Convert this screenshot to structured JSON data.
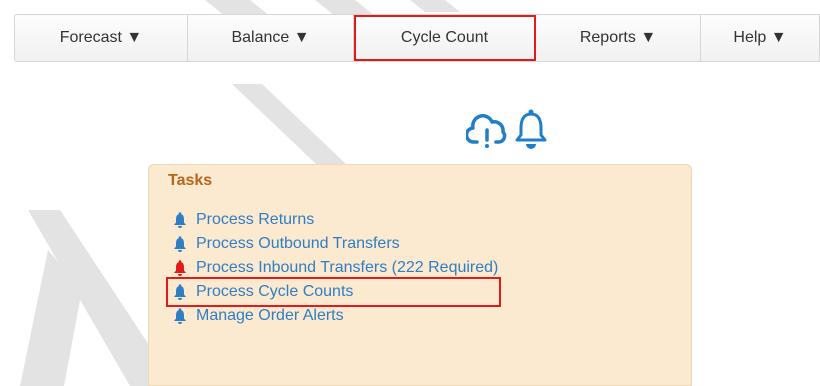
{
  "nav": {
    "items": [
      {
        "label": "Forecast ▼"
      },
      {
        "label": "Balance ▼"
      },
      {
        "label": "Cycle Count"
      },
      {
        "label": "Reports ▼"
      },
      {
        "label": "Help ▼"
      }
    ]
  },
  "icons": {
    "cloud": "cloud-alert-icon",
    "bell": "bell-icon",
    "color": "#1e7ec8"
  },
  "tasks": {
    "title": "Tasks",
    "items": [
      {
        "label": "Process Returns",
        "bell_color": "#2f7ec4"
      },
      {
        "label": "Process Outbound Transfers",
        "bell_color": "#2f7ec4"
      },
      {
        "label": "Process Inbound Transfers (222 Required)",
        "bell_color": "#e01b1b"
      },
      {
        "label": "Process Cycle Counts",
        "bell_color": "#2f7ec4"
      },
      {
        "label": "Manage Order Alerts",
        "bell_color": "#2f7ec4"
      }
    ]
  },
  "colors": {
    "highlight": "#e01b1b",
    "panel_bg": "#fbe9d0",
    "link": "#2f7ec4",
    "title": "#b5661a"
  }
}
